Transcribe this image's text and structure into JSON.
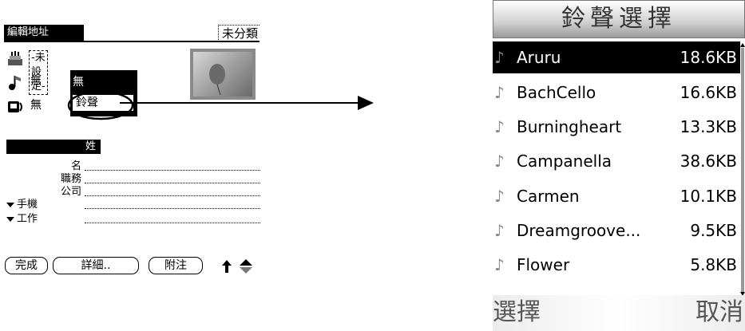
{
  "palm": {
    "header_title": "編輯地址",
    "category": "未分類",
    "row1_value": "-未設定-",
    "row2_value": "無",
    "row3_value": "無",
    "popup": {
      "items": [
        "無",
        "鈴聲"
      ],
      "selected": "鈴聲"
    },
    "section_label": "姓",
    "fields": [
      {
        "label": "名",
        "dropdown": false
      },
      {
        "label": "職務",
        "dropdown": false
      },
      {
        "label": "公司",
        "dropdown": false
      },
      {
        "label": "手機",
        "dropdown": true
      },
      {
        "label": "工作",
        "dropdown": true
      }
    ],
    "buttons": {
      "done": "完成",
      "details": "詳細..",
      "note": "附注"
    },
    "icons": [
      "birthday-cake-icon",
      "music-note-icon",
      "phone-icon",
      "photo-icon",
      "scroll-arrow-icon"
    ]
  },
  "ringtones": {
    "title": "鈴聲選擇",
    "items": [
      {
        "name": "Aruru",
        "size": "18.6KB",
        "selected": true
      },
      {
        "name": "BachCello",
        "size": "16.6KB",
        "selected": false
      },
      {
        "name": "Burningheart",
        "size": "13.3KB",
        "selected": false
      },
      {
        "name": "Campanella",
        "size": "38.6KB",
        "selected": false
      },
      {
        "name": "Carmen",
        "size": "10.1KB",
        "selected": false
      },
      {
        "name": "Dreamgroove...",
        "size": "9.5KB",
        "selected": false
      },
      {
        "name": "Flower",
        "size": "5.8KB",
        "selected": false
      }
    ],
    "select_label": "選擇",
    "cancel_label": "取消"
  },
  "colors": {
    "selection": "#000000",
    "background": "#ffffff",
    "title_gradient": "#cfcfcf"
  }
}
